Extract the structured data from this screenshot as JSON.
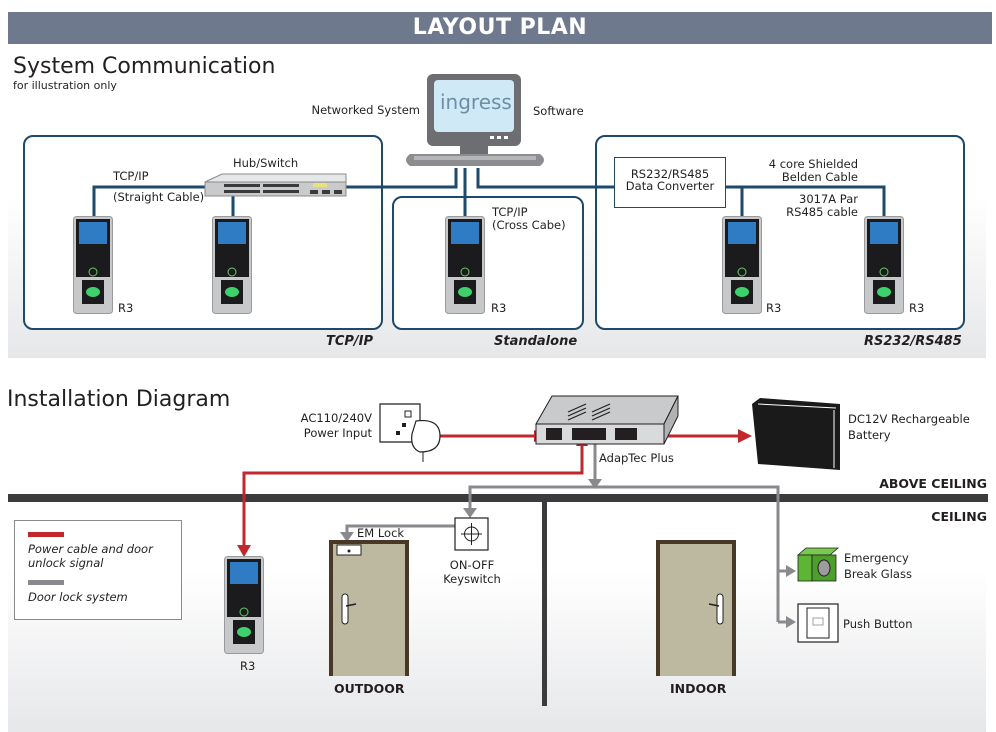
{
  "banner": {
    "title": "LAYOUT PLAN"
  },
  "system_communication": {
    "title": "System Communication",
    "subtitle": "for illustration only",
    "pc": {
      "left_label": "Networked System",
      "logo_text": "ingress",
      "right_label": "Software"
    },
    "groups": [
      {
        "name": "TCP/IP",
        "hub_label": "Hub/Switch",
        "cable_label_1": "TCP/IP",
        "cable_label_2": "(Straight Cable)",
        "device_label": "R3"
      },
      {
        "name": "Standalone",
        "cable_label_1": "TCP/IP",
        "cable_label_2": "(Cross Cabe)",
        "device_label": "R3"
      },
      {
        "name": "RS232/RS485",
        "converter_line1": "RS232/RS485",
        "converter_line2": "Data Converter",
        "cable_a_line1": "4 core Shielded",
        "cable_a_line2": "Belden Cable",
        "cable_b_line1": "3017A Par",
        "cable_b_line2": "RS485 cable",
        "device_label_1": "R3",
        "device_label_2": "R3"
      }
    ]
  },
  "installation": {
    "title": "Installation Diagram",
    "power_input": {
      "line1": "AC110/240V",
      "line2": "Power Input"
    },
    "adaptec_label": "AdapTec Plus",
    "battery": {
      "line1": "DC12V Rechargeable",
      "line2": "Battery"
    },
    "above_ceiling": "ABOVE CEILING",
    "ceiling": "CEILING",
    "legend": [
      {
        "color": "#c1272d",
        "line1": "Power cable and door",
        "line2": "unlock signal"
      },
      {
        "color": "#8a8a8e",
        "line1": "Door lock system"
      }
    ],
    "reader_label": "R3",
    "em_lock": "EM Lock",
    "keyswitch": {
      "line1": "ON-OFF",
      "line2": "Keyswitch"
    },
    "outdoor": "OUTDOOR",
    "indoor": "INDOOR",
    "break_glass": {
      "line1": "Emergency",
      "line2": "Break Glass"
    },
    "push_button": "Push Button"
  },
  "colors": {
    "banner": "#6e798e",
    "network_line": "#1e4a6a",
    "power": "#c1272d",
    "lock": "#8a8a8e",
    "door": "#bdb8a0",
    "door_frame": "#4a3826",
    "break_glass": "#5cb535"
  }
}
